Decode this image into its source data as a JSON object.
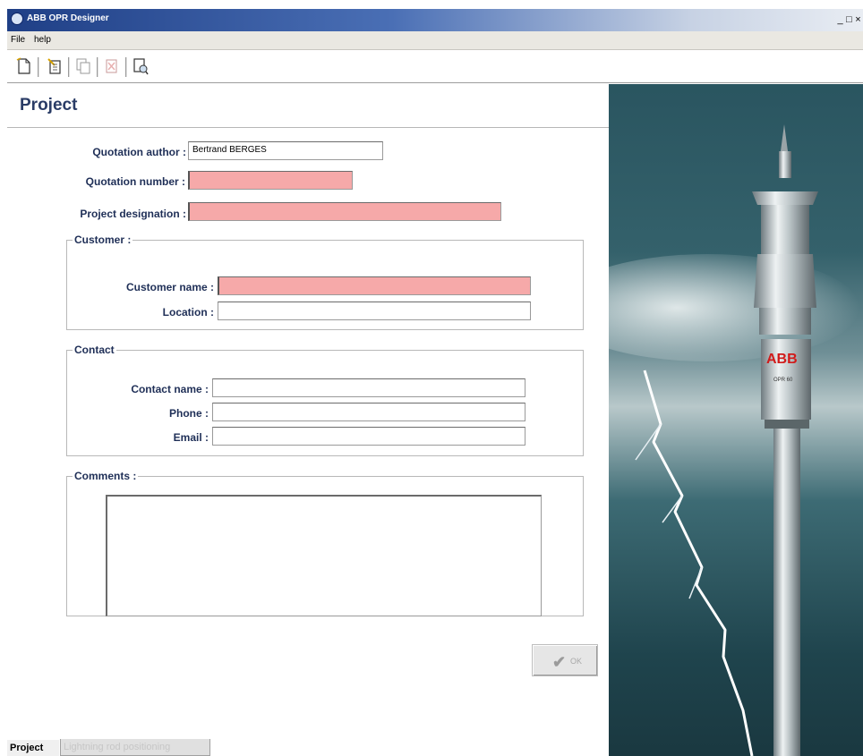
{
  "window": {
    "title": "ABB OPR Designer",
    "controls": [
      "_",
      "□",
      "×"
    ]
  },
  "menu": {
    "file": "File",
    "help": "help"
  },
  "toolbar": {
    "icons": [
      "new-document-icon",
      "edit-icon",
      "copy-icon",
      "delete-icon",
      "print-preview-icon"
    ]
  },
  "project": {
    "heading": "Project",
    "author_label": "Quotation author :",
    "author_value": "Bertrand BERGES",
    "number_label": "Quotation number :",
    "number_value": "",
    "designation_label": "Project designation :",
    "designation_value": ""
  },
  "customer": {
    "legend": "Customer :",
    "name_label": "Customer name :",
    "name_value": "",
    "location_label": "Location :",
    "location_value": ""
  },
  "contact": {
    "legend": "Contact",
    "name_label": "Contact name :",
    "name_value": "",
    "phone_label": "Phone :",
    "phone_value": "",
    "email_label": "Email :",
    "email_value": ""
  },
  "comments": {
    "legend": "Comments :",
    "value": ""
  },
  "ok_button": {
    "label": "OK"
  },
  "tabs": [
    {
      "label": "Project",
      "active": true
    },
    {
      "label": "Lightning rod positioning",
      "active": false
    }
  ],
  "image": {
    "brand": "ABB",
    "product_label": "OPR 60"
  },
  "colors": {
    "required_field": "#f6a9a9",
    "label_text": "#1f2f57",
    "title_bar": "#1f3f86"
  }
}
